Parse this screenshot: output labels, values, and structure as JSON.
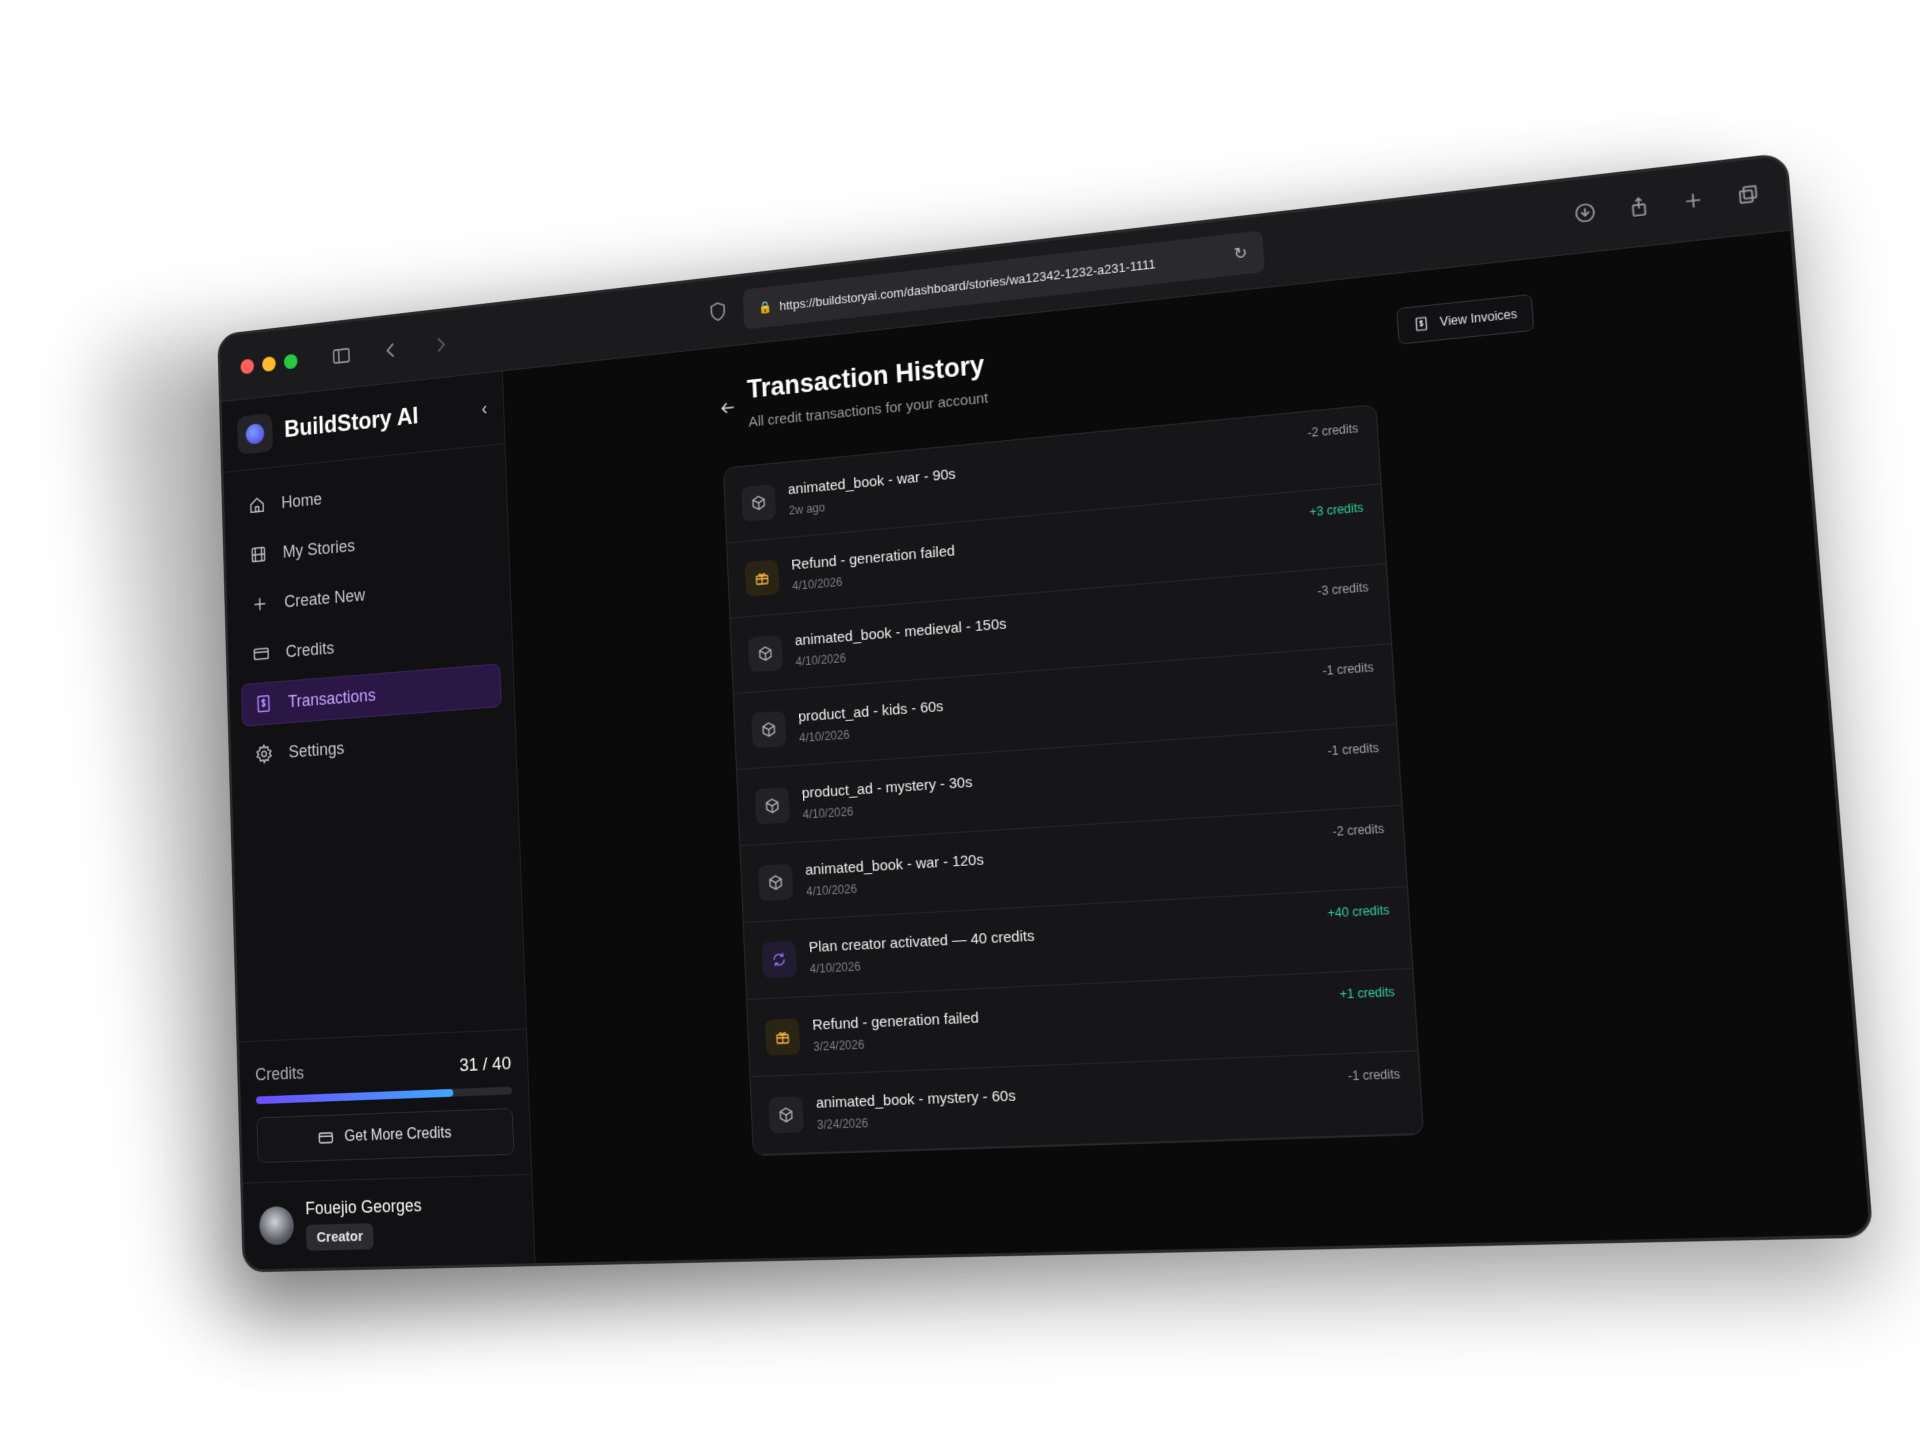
{
  "browser": {
    "url": "https://buildstoryai.com/dashboard/stories/wa12342-1232-a231-1111"
  },
  "sidebar": {
    "brand": "BuildStory AI",
    "items": [
      {
        "label": "Home",
        "icon": "home-icon"
      },
      {
        "label": "My Stories",
        "icon": "film-icon"
      },
      {
        "label": "Create New",
        "icon": "plus-icon"
      },
      {
        "label": "Credits",
        "icon": "card-icon"
      },
      {
        "label": "Transactions",
        "icon": "receipt-icon",
        "active": true
      },
      {
        "label": "Settings",
        "icon": "gear-icon"
      }
    ],
    "credits": {
      "label": "Credits",
      "value": "31 / 40",
      "used": 31,
      "total": 40,
      "button_label": "Get More Credits"
    },
    "user": {
      "name": "Fouejio Georges",
      "role": "Creator"
    }
  },
  "main": {
    "title": "Transaction History",
    "subtitle": "All credit transactions for your account",
    "invoices_label": "View Invoices",
    "transactions": [
      {
        "title": "animated_book - war - 90s",
        "date": "2w ago",
        "amount": "-2 credits",
        "type": "cube"
      },
      {
        "title": "Refund - generation failed",
        "date": "4/10/2026",
        "amount": "+3 credits",
        "type": "gift"
      },
      {
        "title": "animated_book - medieval - 150s",
        "date": "4/10/2026",
        "amount": "-3 credits",
        "type": "cube"
      },
      {
        "title": "product_ad - kids - 60s",
        "date": "4/10/2026",
        "amount": "-1 credits",
        "type": "cube"
      },
      {
        "title": "product_ad - mystery - 30s",
        "date": "4/10/2026",
        "amount": "-1 credits",
        "type": "cube"
      },
      {
        "title": "animated_book - war - 120s",
        "date": "4/10/2026",
        "amount": "-2 credits",
        "type": "cube"
      },
      {
        "title": "Plan creator activated — 40 credits",
        "date": "4/10/2026",
        "amount": "+40 credits",
        "type": "sync"
      },
      {
        "title": "Refund - generation failed",
        "date": "3/24/2026",
        "amount": "+1 credits",
        "type": "gift"
      },
      {
        "title": "animated_book - mystery - 60s",
        "date": "3/24/2026",
        "amount": "-1 credits",
        "type": "cube"
      }
    ]
  },
  "colors": {
    "accent_purple": "#b68cff",
    "positive_green": "#2fd09a",
    "gift_orange": "#f3b33d"
  }
}
